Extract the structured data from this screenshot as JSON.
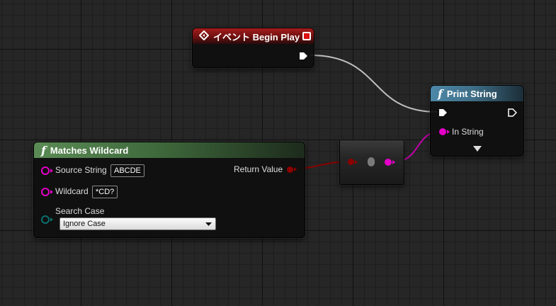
{
  "nodes": {
    "event_begin_play": {
      "title": "イベント Begin Play"
    },
    "print_string": {
      "title": "Print String",
      "pins": {
        "in_string": "In String"
      }
    },
    "matches_wildcard": {
      "title": "Matches Wildcard",
      "pins": {
        "source_string": {
          "label": "Source String",
          "value": "ABCDE"
        },
        "wildcard": {
          "label": "Wildcard",
          "value": "*CD?"
        },
        "search_case": {
          "label": "Search Case",
          "value": "Ignore Case"
        },
        "return_value": "Return Value"
      }
    }
  },
  "colors": {
    "exec_wire": "#bfbfbf",
    "bool_pin": "#8c0000",
    "string_pin": "#e400c9",
    "search_case_pin": "#0b6e6e",
    "event_header": "#a51d1d",
    "function_header_blue": "#4d88a8",
    "function_header_green": "#5b8b55"
  },
  "icons": {
    "event": "event-diamond-icon",
    "function": "function-f-icon",
    "exec": "exec-arrow-pin",
    "advanced": "expand-triangle-icon",
    "dropdown": "dropdown-arrow-icon"
  }
}
